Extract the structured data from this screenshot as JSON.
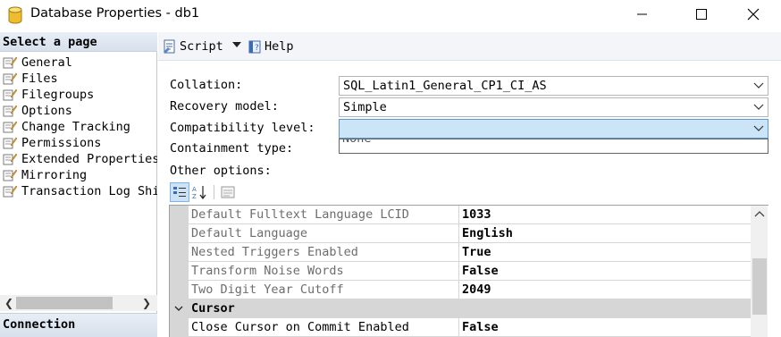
{
  "window": {
    "title": "Database Properties - db1",
    "icon": "database-icon",
    "controls": [
      "minimize-icon",
      "maximize-icon",
      "close-icon"
    ]
  },
  "left_panel": {
    "header": "Select a page",
    "pages": [
      {
        "label": "General",
        "icon": "page-icon"
      },
      {
        "label": "Files",
        "icon": "page-icon"
      },
      {
        "label": "Filegroups",
        "icon": "page-icon"
      },
      {
        "label": "Options",
        "icon": "page-icon"
      },
      {
        "label": "Change Tracking",
        "icon": "page-icon"
      },
      {
        "label": "Permissions",
        "icon": "page-icon"
      },
      {
        "label": "Extended Properties",
        "icon": "page-icon"
      },
      {
        "label": "Mirroring",
        "icon": "page-icon"
      },
      {
        "label": "Transaction Log Shi",
        "icon": "page-icon"
      }
    ],
    "connection_header": "Connection"
  },
  "toolbar": {
    "script_label": "Script",
    "help_label": "Help"
  },
  "form": {
    "collation": {
      "label": "Collation:",
      "value": "SQL_Latin1_General_CP1_CI_AS"
    },
    "recovery_model": {
      "label": "Recovery model:",
      "value": "Simple"
    },
    "compatibility_level": {
      "label": "Compatibility level:",
      "value": ""
    },
    "containment_type": {
      "label": "Containment type:",
      "value": "None"
    },
    "other_options_label": "Other options:"
  },
  "property_grid": {
    "rows": [
      {
        "name": "Default Fulltext Language LCID",
        "value": "1033",
        "kind": "readonly"
      },
      {
        "name": "Default Language",
        "value": "English",
        "kind": "readonly"
      },
      {
        "name": "Nested Triggers Enabled",
        "value": "True",
        "kind": "readonly"
      },
      {
        "name": "Transform Noise Words",
        "value": "False",
        "kind": "readonly"
      },
      {
        "name": "Two Digit Year Cutoff",
        "value": "2049",
        "kind": "readonly"
      },
      {
        "name": "Cursor",
        "value": "",
        "kind": "category"
      },
      {
        "name": "Close Cursor on Commit Enabled",
        "value": "False",
        "kind": "normal"
      }
    ]
  },
  "colors": {
    "header_gradient_top": "#e8eef6",
    "header_gradient_bottom": "#d7e0ec",
    "active_combo": "#cce4f7",
    "active_border": "#5b9bd5"
  }
}
